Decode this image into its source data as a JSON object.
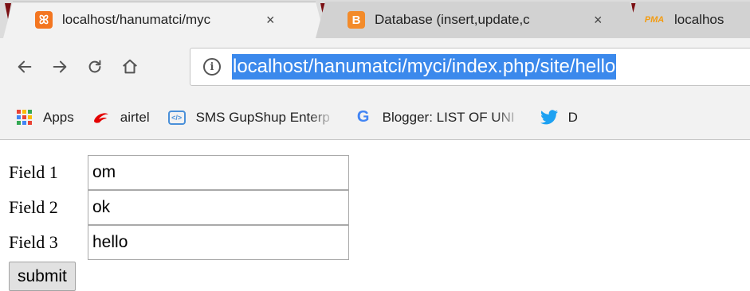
{
  "tabs": [
    {
      "title": "localhost/hanumatci/myc",
      "favicon": "xampp-icon",
      "active": true,
      "close": "×"
    },
    {
      "title": "Database (insert,update,c",
      "favicon": "blogger-icon",
      "active": false,
      "close": "×"
    },
    {
      "title": "localhos",
      "favicon": "phpmyadmin-icon",
      "active": false
    }
  ],
  "favicon_text": {
    "xampp": "ꕤ",
    "blogger": "B",
    "pma": "PMA"
  },
  "address_bar": {
    "url": "localhost/hanumatci/myci/index.php/site/hello",
    "info": "i"
  },
  "bookmarks": [
    {
      "label": "Apps",
      "icon": "apps-icon"
    },
    {
      "label": "airtel",
      "icon": "airtel-icon"
    },
    {
      "label": "SMS GupShup Enterp",
      "icon": "gupshup-icon"
    },
    {
      "label": "Blogger: LIST OF UNI",
      "icon": "google-icon"
    },
    {
      "label": "D",
      "icon": "twitter-icon"
    }
  ],
  "bookmark_glyphs": {
    "google": "G",
    "gupshup": "</>"
  },
  "form": {
    "fields": [
      {
        "label": "Field 1",
        "value": "om"
      },
      {
        "label": "Field 2",
        "value": "ok"
      },
      {
        "label": "Field 3",
        "value": "hello"
      }
    ],
    "submit_label": "submit"
  },
  "colors": {
    "url_highlight": "#3b89ec",
    "xampp_orange": "#f37621",
    "blogger_orange": "#f38b2a",
    "twitter_blue": "#1da1f2",
    "airtel_red": "#e40000"
  }
}
